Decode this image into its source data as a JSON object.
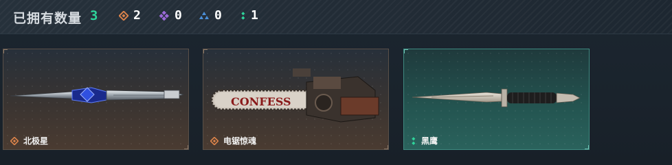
{
  "header": {
    "owned_label": "已拥有数量",
    "owned_count": "3",
    "stats": [
      {
        "icon": "orange-diamond-icon",
        "color": "#d9824a",
        "value": "2"
      },
      {
        "icon": "purple-diamond-cluster-icon",
        "color": "#9b6ad8",
        "value": "0"
      },
      {
        "icon": "blue-triangle-cluster-icon",
        "color": "#4b8fd8",
        "value": "0"
      },
      {
        "icon": "green-double-dot-icon",
        "color": "#2fd49b",
        "value": "1"
      }
    ]
  },
  "cards": [
    {
      "name": "北极星",
      "rarity_icon": "orange-diamond-icon",
      "rarity_color": "#d9824a",
      "weapon": "dagger-blue-icon"
    },
    {
      "name": "电锯惊魂",
      "rarity_icon": "orange-diamond-icon",
      "rarity_color": "#d9824a",
      "weapon": "chainsaw-icon",
      "weapon_text": "CONFESS"
    },
    {
      "name": "黑鹰",
      "rarity_icon": "green-double-dot-icon",
      "rarity_color": "#2fd49b",
      "weapon": "combat-knife-icon"
    }
  ]
}
